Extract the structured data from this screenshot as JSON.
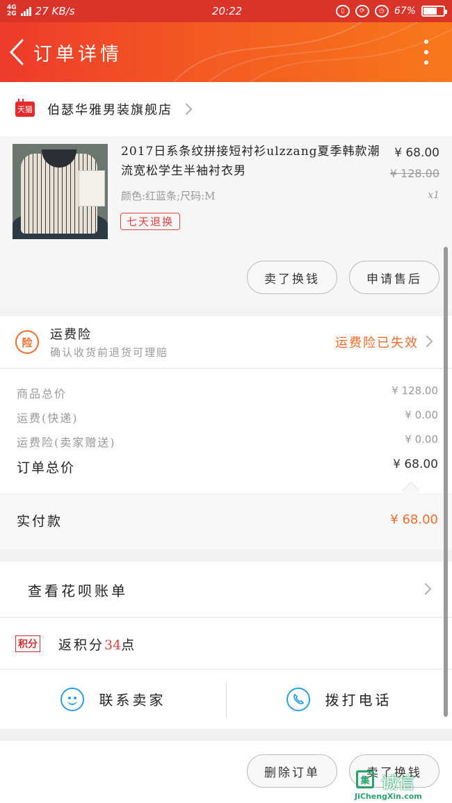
{
  "status_bar": {
    "network_top": "4G",
    "network_bottom": "2G",
    "speed": "27 KB/s",
    "time": "20:22",
    "battery": "67%",
    "battery_level": 0.67
  },
  "header": {
    "title": "订单详情",
    "bg_colors": [
      "#ee3a2c",
      "#f7781c"
    ]
  },
  "store": {
    "badge": "天猫",
    "name": "伯瑟华雅男装旗舰店"
  },
  "product": {
    "title": "2017日系条纹拼接短衬衫ulzzang夏季韩款潮流宽松学生半袖衬衣男",
    "price": "¥ 68.00",
    "original_price": "¥ 128.00",
    "spec": "颜色:红蓝条;尺码:M",
    "quantity": "x1",
    "return_tag": "七天退换",
    "actions": {
      "change": "卖了换钱",
      "aftersale": "申请售后"
    }
  },
  "insurance": {
    "icon_text": "险",
    "title": "运费险",
    "subtitle": "确认收货前退货可理赔",
    "status": "运费险已失效",
    "accent": "#f06a2a"
  },
  "summary": {
    "rows": [
      {
        "label": "商品总价",
        "value": "¥ 128.00"
      },
      {
        "label": "运费(快递)",
        "value": "¥ 0.00"
      },
      {
        "label": "运费险(卖家赠送)",
        "value": "¥ 0.00"
      }
    ],
    "total_label": "订单总价",
    "total_value": "¥ 68.00"
  },
  "paid": {
    "label": "实付款",
    "amount": "¥ 68.00"
  },
  "huabei": {
    "label": "查看花呗账单"
  },
  "points": {
    "badge": "积分",
    "prefix": "返积分",
    "count": "34",
    "suffix": "点"
  },
  "contact": {
    "seller": "联系卖家",
    "call": "拨打电话",
    "icon_color": "#2a9ee6"
  },
  "bottom_actions": {
    "delete": "删除订单",
    "change": "卖了换钱"
  },
  "watermark": {
    "box": "集",
    "cn": "诚信",
    "url": "JiChengXin.com"
  }
}
